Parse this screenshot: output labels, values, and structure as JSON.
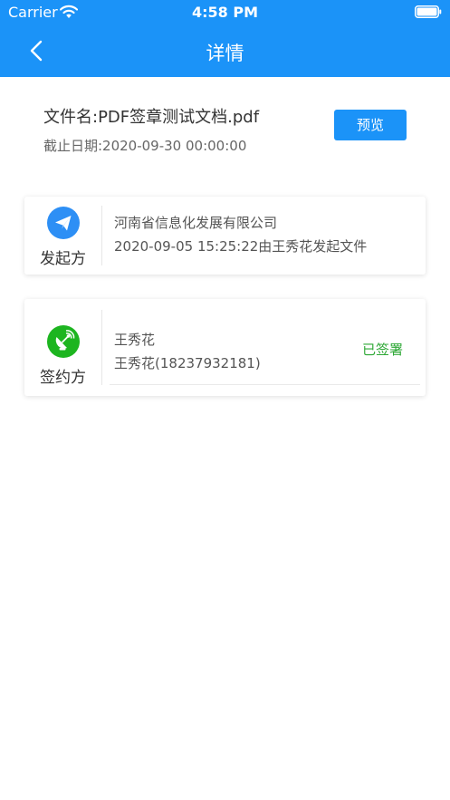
{
  "status_bar": {
    "carrier": "Carrier",
    "time": "4:58 PM"
  },
  "nav": {
    "title": "详情"
  },
  "file": {
    "name": "文件名:PDF签章测试文档.pdf",
    "deadline": "截止日期:2020-09-30 00:00:00",
    "preview_label": "预览"
  },
  "initiator": {
    "label": "发起方",
    "icon": "paper-plane-icon",
    "company": "河南省信息化发展有限公司",
    "detail": "2020-09-05 15:25:22由王秀花发起文件"
  },
  "signer": {
    "label": "签约方",
    "icon": "satellite-dish-icon",
    "name": "王秀花",
    "detail": "王秀花(18237932181)",
    "status": "已签署"
  },
  "colors": {
    "primary": "#1b93f8",
    "signer_icon": "#1db520",
    "signed_status": "#2ea836"
  }
}
